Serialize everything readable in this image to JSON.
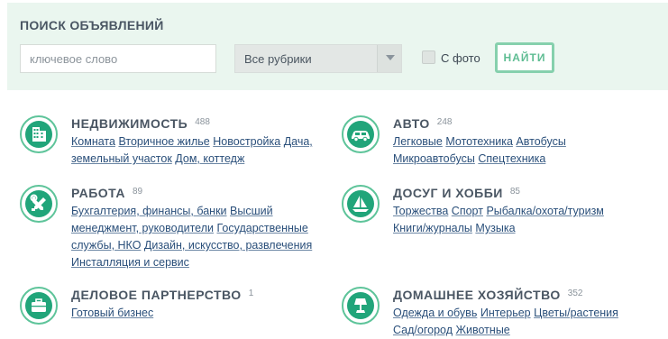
{
  "search": {
    "title": "ПОИСК ОБЪЯВЛЕНИЙ",
    "keyword_placeholder": "ключевое слово",
    "keyword_value": "",
    "rubric_selected": "Все рубрики",
    "photo_label": "С фото",
    "photo_checked": false,
    "find_label": "НАЙТИ"
  },
  "categories": [
    {
      "title": "НЕДВИЖИМОСТЬ",
      "count": "488",
      "icon": "building-icon",
      "links": [
        "Комната",
        "Вторичное жилье",
        "Новостройка",
        "Дача,",
        "земельный участок",
        "Дом, коттедж"
      ]
    },
    {
      "title": "АВТО",
      "count": "248",
      "icon": "car-icon",
      "links": [
        "Легковые",
        "Мототехника",
        "Автобусы",
        "Микроавтобусы",
        "Спецтехника"
      ]
    },
    {
      "title": "РАБОТА",
      "count": "89",
      "icon": "tools-icon",
      "links": [
        "Бухгалтерия, финансы, банки",
        "Высший",
        "менеджмент, руководители",
        "Государственные",
        "службы, НКО",
        "Дизайн, искусство, развлечения",
        "Инсталляция и сервис"
      ]
    },
    {
      "title": "ДОСУГ И ХОББИ",
      "count": "85",
      "icon": "sailboat-icon",
      "links": [
        "Торжества",
        "Спорт",
        "Рыбалка/охота/туризм",
        "Книги/журналы",
        "Музыка"
      ]
    },
    {
      "title": "ДЕЛОВОЕ ПАРТНЕРСТВО",
      "count": "1",
      "icon": "briefcase-icon",
      "links": [
        "Готовый бизнес"
      ]
    },
    {
      "title": "ДОМАШНЕЕ ХОЗЯЙСТВО",
      "count": "352",
      "icon": "lamp-icon",
      "links": [
        "Одежда и обувь",
        "Интерьер",
        "Цветы/растения",
        "Сад/огород",
        "Животные"
      ]
    }
  ],
  "colors": {
    "accent_green": "#21a57a",
    "ring_green": "#5ec49a",
    "panel_bg": "#eaf6ef",
    "link_blue": "#2a4f7a"
  }
}
